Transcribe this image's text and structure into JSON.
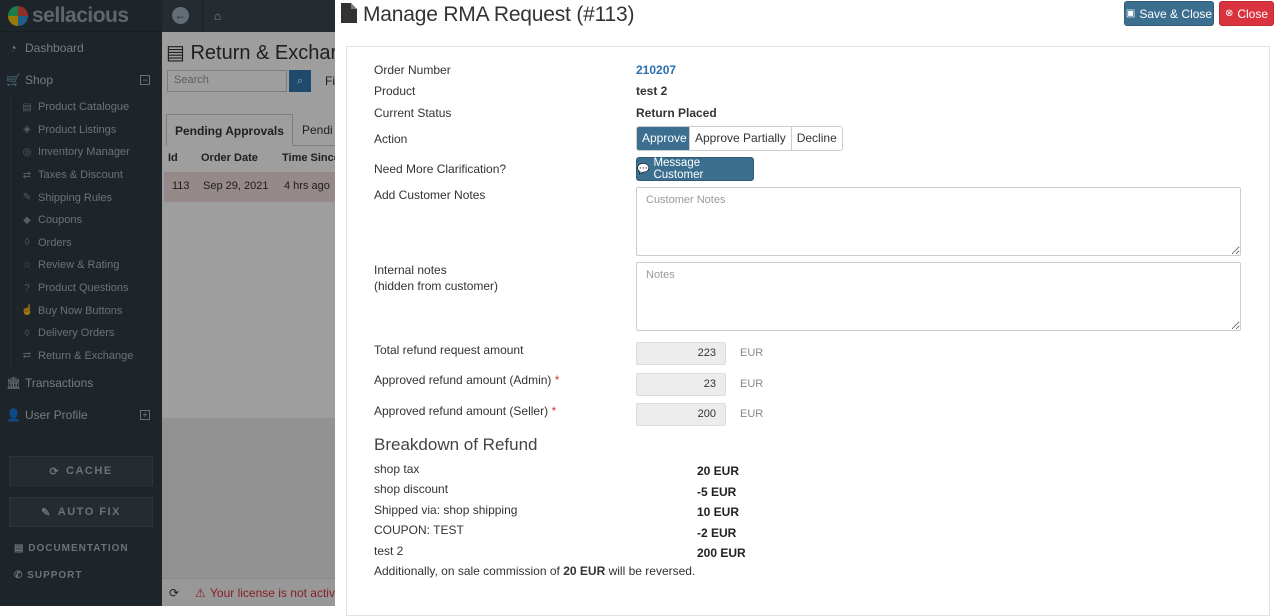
{
  "app": {
    "logo_text": "sellacious",
    "sidebar": {
      "dashboard": "Dashboard",
      "shop": "Shop",
      "shop_items": [
        "Product Catalogue",
        "Product Listings",
        "Inventory Manager",
        "Taxes & Discount",
        "Shipping Rules",
        "Coupons",
        "Orders",
        "Review & Rating",
        "Product Questions",
        "Buy Now Buttons",
        "Delivery Orders",
        "Return & Exchange"
      ],
      "transactions": "Transactions",
      "user_profile": "User Profile",
      "cache_label": "CACHE",
      "autofix_label": "AUTO FIX",
      "documentation": "DOCUMENTATION",
      "support": "SUPPORT"
    },
    "background": {
      "title": "Return & Exchar",
      "search_placeholder": "Search",
      "filter_text": "Fi",
      "tabs": [
        "Pending Approvals",
        "Pendi"
      ],
      "table_headers": [
        "Id",
        "Order Date",
        "Time Since"
      ],
      "row": [
        "113",
        "Sep 29, 2021",
        "4 hrs ago"
      ],
      "license_text": "Your license is not activ"
    }
  },
  "modal": {
    "title": "Manage RMA Request (#113)",
    "save_close_label": "Save & Close",
    "close_label": "Close",
    "fields": {
      "order_number_label": "Order Number",
      "order_number": "210207",
      "product_label": "Product",
      "product": "test 2",
      "status_label": "Current Status",
      "status": "Return Placed",
      "action_label": "Action",
      "actions": [
        "Approve",
        "Approve Partially",
        "Decline"
      ],
      "selected_action": "Approve",
      "clarify_label": "Need More Clarification?",
      "message_btn": "Message Customer",
      "customer_notes_label": "Add Customer Notes",
      "customer_notes_placeholder": "Customer Notes",
      "customer_notes_value": "",
      "internal_notes_label": "Internal notes",
      "internal_notes_sub": "(hidden from customer)",
      "internal_notes_placeholder": "Notes",
      "internal_notes_value": "",
      "total_label": "Total refund request amount",
      "total_value": "223",
      "admin_label": "Approved refund amount (Admin)",
      "admin_value": "23",
      "seller_label": "Approved refund amount (Seller)",
      "seller_value": "200",
      "required_mark": "*",
      "currency": "EUR"
    },
    "breakdown": {
      "title": "Breakdown of Refund",
      "items": [
        {
          "label": "shop tax",
          "value": "20 EUR"
        },
        {
          "label": "shop discount",
          "value": "-5 EUR"
        },
        {
          "label": "Shipped via: shop shipping",
          "value": "10 EUR"
        },
        {
          "label": "COUPON: TEST",
          "value": "-2 EUR"
        },
        {
          "label": "test 2",
          "value": "200 EUR"
        }
      ],
      "note_prefix": "Additionally, on sale commission of",
      "note_amount": "20 EUR",
      "note_suffix": "will be reversed."
    }
  },
  "colors": {
    "sidebar_bg": "#2f3b44",
    "primary_button": "#3b6e8f",
    "danger_button": "#d9333f",
    "link": "#2a6fb0",
    "required": "#d9333f"
  }
}
